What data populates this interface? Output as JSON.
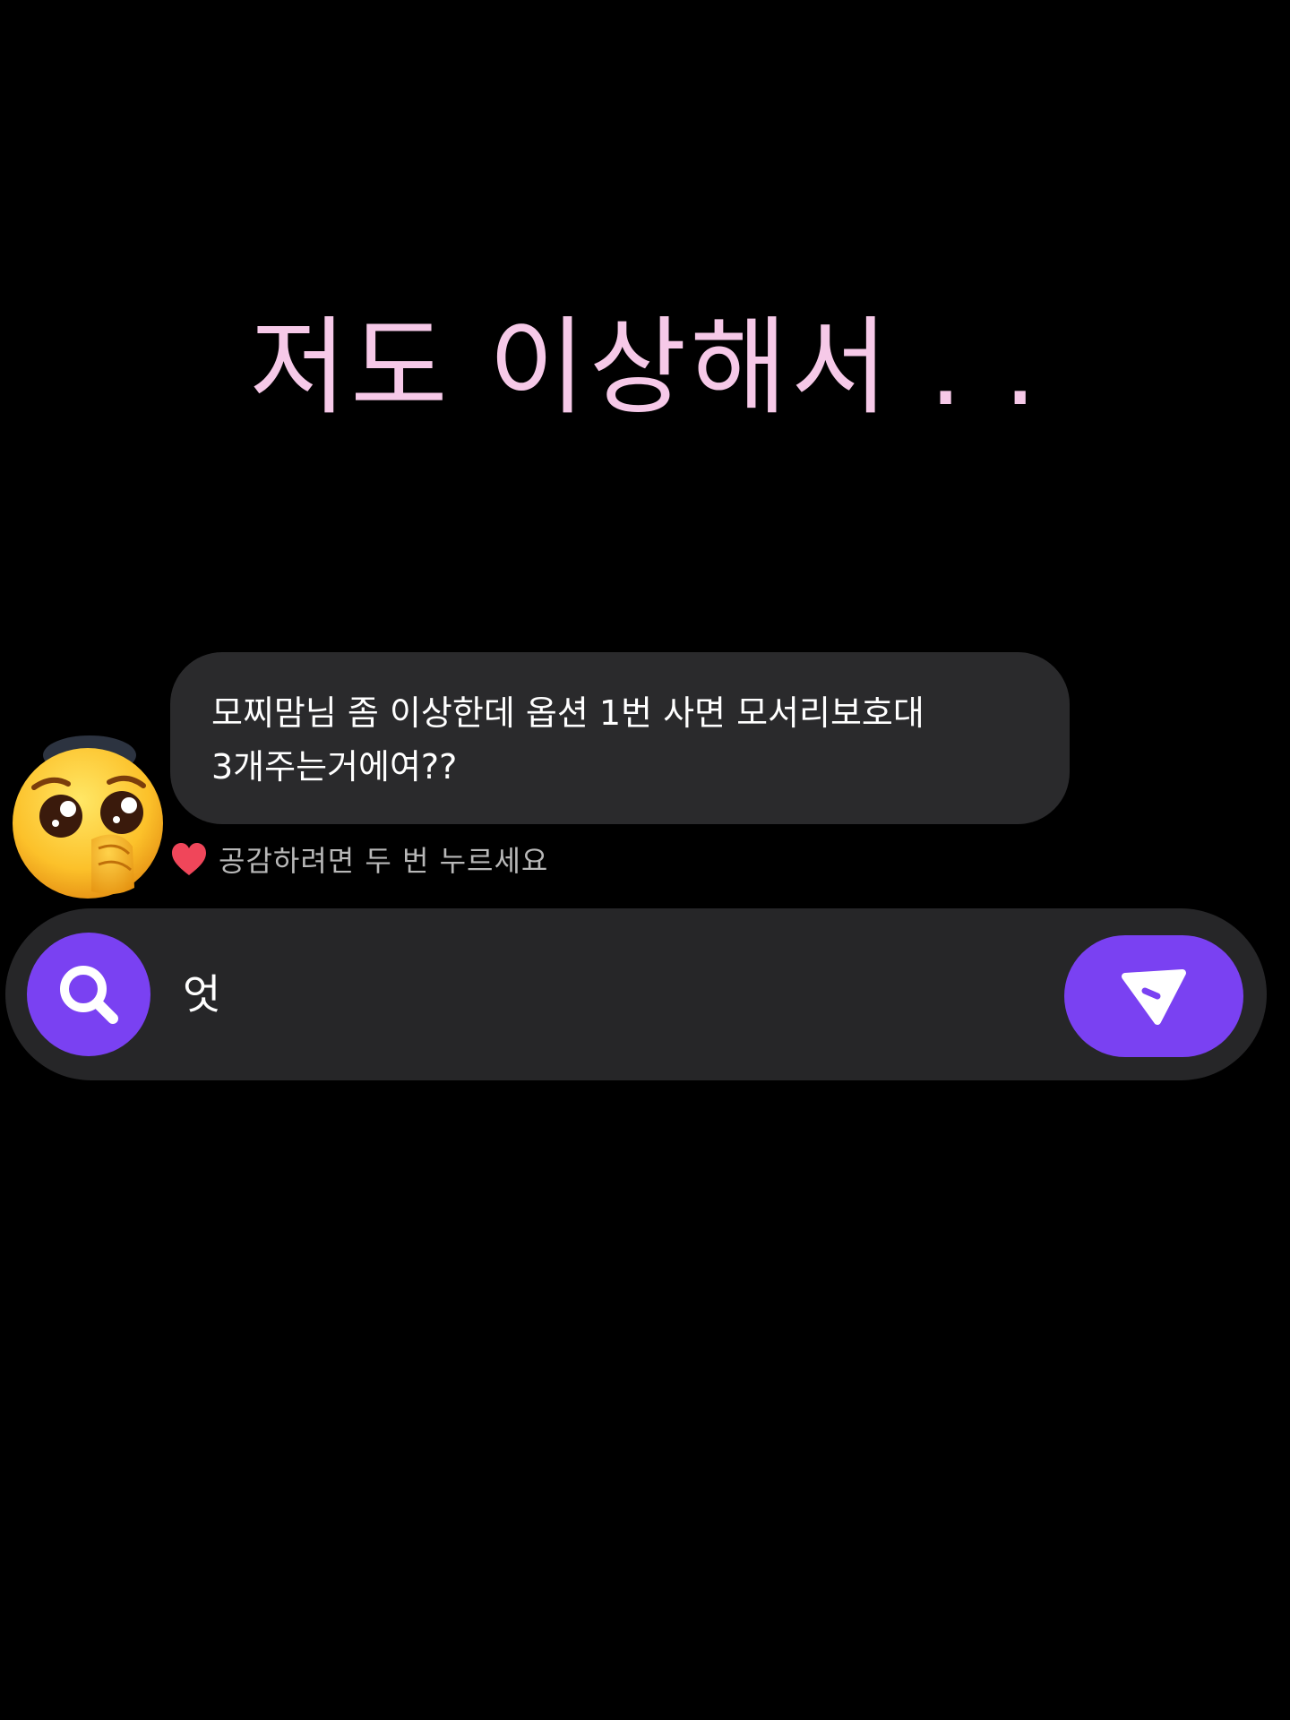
{
  "caption": {
    "text": "저도 이상해서 . .",
    "color": "#f6c9e8"
  },
  "comment": {
    "avatar_icon": "pleading-face-hand-over-mouth-emoji",
    "lines": [
      "모찌맘님 좀 이상한데 옵션 1번 사면 모서리보호대",
      "3개주는거에여??"
    ],
    "bubble_color": "#2a2a2c"
  },
  "like_hint": {
    "icon": "heart-icon",
    "text": "공감하려면 두 번 누르세요",
    "heart_color": "#f0465a"
  },
  "reply_bar": {
    "background": "#262628",
    "accent": "#7a41f2",
    "search_icon": "search-icon",
    "input_value": "엇",
    "send_icon": "send-icon"
  }
}
